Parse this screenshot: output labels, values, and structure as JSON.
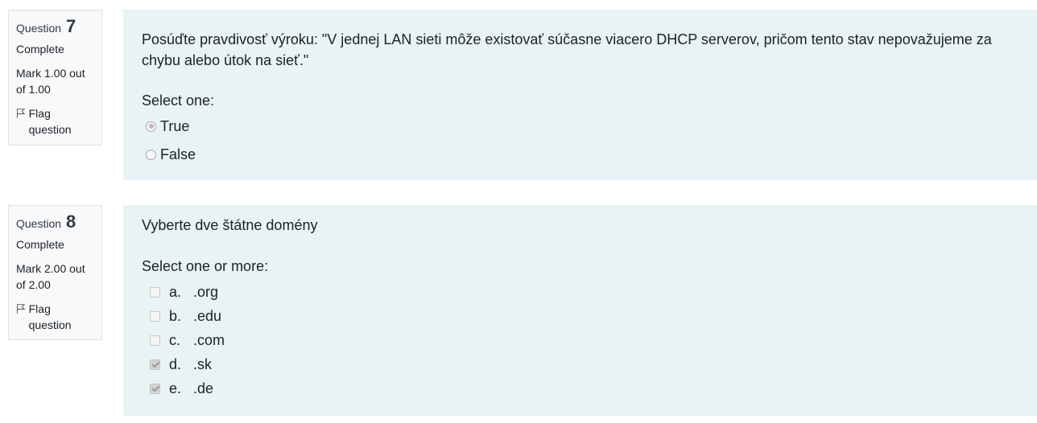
{
  "questions": [
    {
      "label": "Question",
      "number": "7",
      "state": "Complete",
      "grade": "Mark 1.00 out of 1.00",
      "flag": "Flag question",
      "text": "Posúďte pravdivosť výroku: \"V jednej LAN sieti môže existovať súčasne viacero DHCP serverov, pričom tento stav nepovažujeme za chybu alebo útok na sieť.\"",
      "prompt": "Select one:",
      "options": [
        {
          "label": "True",
          "checked": true
        },
        {
          "label": "False",
          "checked": false
        }
      ]
    },
    {
      "label": "Question",
      "number": "8",
      "state": "Complete",
      "grade": "Mark 2.00 out of 2.00",
      "flag": "Flag question",
      "text": "Vyberte dve štátne domény",
      "prompt": "Select one or more:",
      "options": [
        {
          "letter": "a.",
          "label": ".org",
          "checked": false
        },
        {
          "letter": "b.",
          "label": ".edu",
          "checked": false
        },
        {
          "letter": "c.",
          "label": ".com",
          "checked": false
        },
        {
          "letter": "d.",
          "label": ".sk",
          "checked": true
        },
        {
          "letter": "e.",
          "label": ".de",
          "checked": true
        }
      ]
    }
  ]
}
